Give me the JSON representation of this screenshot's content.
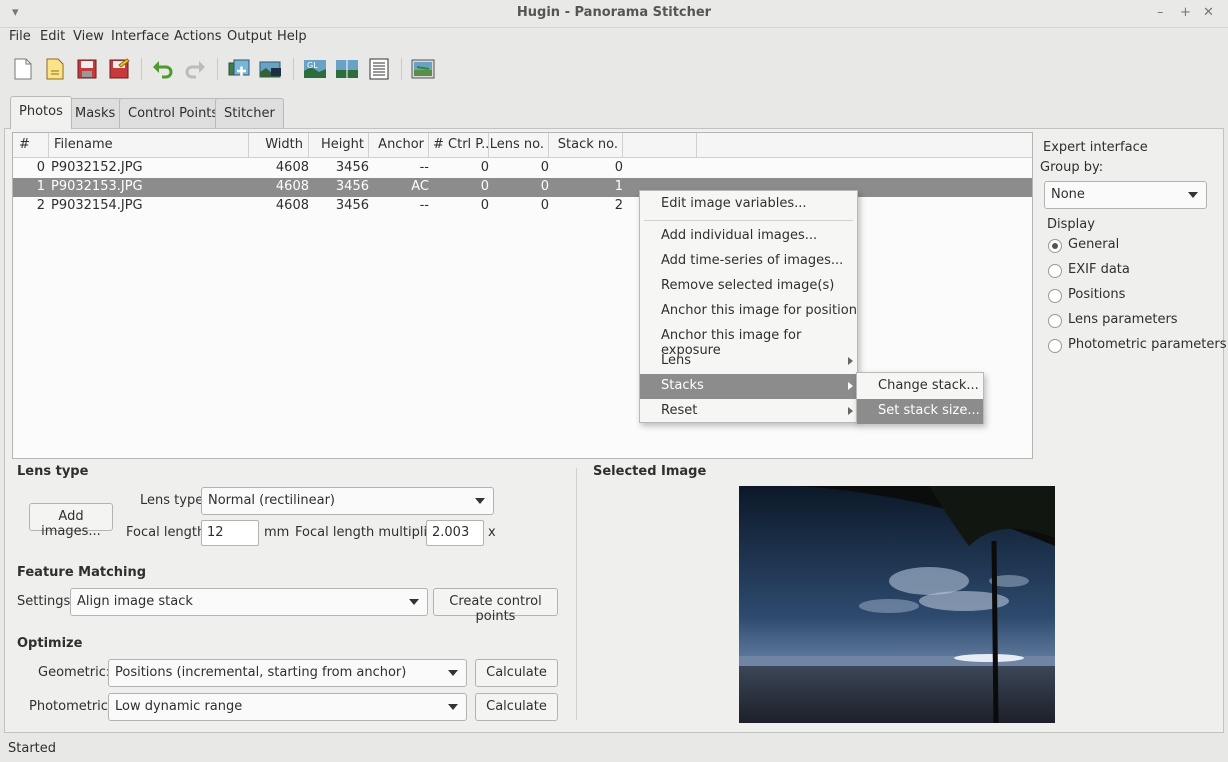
{
  "window": {
    "title": "Hugin - Panorama Stitcher"
  },
  "menubar": [
    "File",
    "Edit",
    "View",
    "Interface",
    "Actions",
    "Output",
    "Help"
  ],
  "toolbar": {
    "buttons": [
      "new-file-icon",
      "open-file-icon",
      "save-icon",
      "save-as-icon",
      "undo-icon",
      "redo-icon",
      "add-images-icon",
      "assistant-icon",
      "gl-preview-icon",
      "fast-preview-icon",
      "layout-icon",
      "control-points-editor-icon"
    ]
  },
  "tabs": [
    "Photos",
    "Masks",
    "Control Points",
    "Stitcher"
  ],
  "image_list": {
    "columns": [
      "#",
      "Filename",
      "Width",
      "Height",
      "Anchor",
      "# Ctrl P...",
      "Lens no.",
      "Stack no."
    ],
    "rows": [
      [
        "0",
        "P9032152.JPG",
        "4608",
        "3456",
        "--",
        "0",
        "0",
        "0"
      ],
      [
        "1",
        "P9032153.JPG",
        "4608",
        "3456",
        "AC",
        "0",
        "0",
        "1"
      ],
      [
        "2",
        "P9032154.JPG",
        "4608",
        "3456",
        "--",
        "0",
        "0",
        "2"
      ]
    ]
  },
  "side": {
    "expert": "Expert interface",
    "group_by_label": "Group by:",
    "group_by_value": "None",
    "display_label": "Display",
    "display_options": [
      "General",
      "EXIF data",
      "Positions",
      "Lens parameters",
      "Photometric parameters"
    ],
    "display_selected": "General"
  },
  "context_menu": {
    "items": [
      "Edit image variables...",
      "Add individual images...",
      "Add time-series of images...",
      "Remove selected image(s)",
      "Anchor this image for position",
      "Anchor this image for exposure",
      "Lens",
      "Stacks",
      "Reset"
    ],
    "highlighted": "Stacks",
    "submenu": [
      "Change stack...",
      "Set stack size..."
    ],
    "submenu_highlighted": "Set stack size..."
  },
  "lens": {
    "heading": "Lens type",
    "add_images": "Add images...",
    "type_label": "Lens type:",
    "type_value": "Normal (rectilinear)",
    "focal_label": "Focal length:",
    "focal_value": "12",
    "focal_unit": "mm",
    "multiplier_label": "Focal length multiplier:",
    "multiplier_value": "2.003",
    "multiplier_unit": "x"
  },
  "feature": {
    "heading": "Feature Matching",
    "settings_label": "Settings:",
    "settings_value": "Align image stack",
    "create_cp": "Create control points"
  },
  "optimize": {
    "heading": "Optimize",
    "geometric_label": "Geometric:",
    "geometric_value": "Positions (incremental, starting from anchor)",
    "photometric_label": "Photometric:",
    "photometric_value": "Low dynamic range",
    "calculate": "Calculate"
  },
  "selected_image": {
    "heading": "Selected Image"
  },
  "status": "Started"
}
